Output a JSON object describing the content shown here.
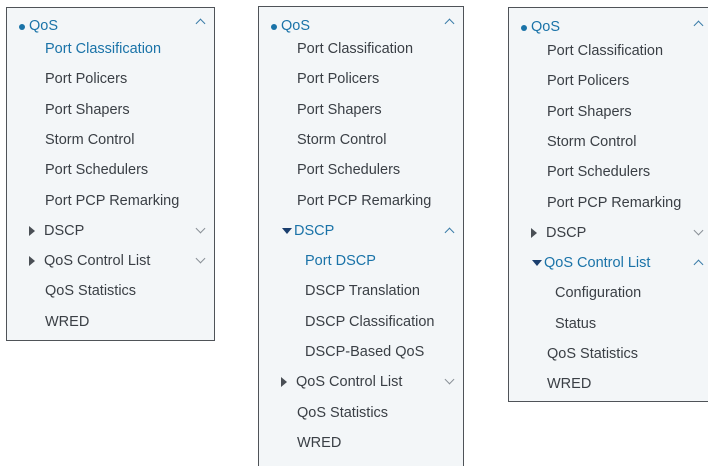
{
  "panels": [
    {
      "root": "QoS",
      "items": [
        "Port Classification",
        "Port Policers",
        "Port Shapers",
        "Storm Control",
        "Port Schedulers",
        "Port PCP Remarking"
      ],
      "active_item": "Port Classification",
      "dscp": {
        "label": "DSCP",
        "expanded": false,
        "children": []
      },
      "qcl": {
        "label": "QoS Control List",
        "expanded": false,
        "children": []
      },
      "tail": [
        "QoS Statistics",
        "WRED"
      ]
    },
    {
      "root": "QoS",
      "items": [
        "Port Classification",
        "Port Policers",
        "Port Shapers",
        "Storm Control",
        "Port Schedulers",
        "Port PCP Remarking"
      ],
      "active_item": "Port DSCP",
      "dscp": {
        "label": "DSCP",
        "expanded": true,
        "children": [
          "Port DSCP",
          "DSCP Translation",
          "DSCP Classification",
          "DSCP-Based QoS"
        ]
      },
      "qcl": {
        "label": "QoS Control List",
        "expanded": false,
        "children": []
      },
      "tail": [
        "QoS Statistics",
        "WRED"
      ]
    },
    {
      "root": "QoS",
      "items": [
        "Port Classification",
        "Port Policers",
        "Port Shapers",
        "Storm Control",
        "Port Schedulers",
        "Port PCP Remarking"
      ],
      "active_item": "",
      "dscp": {
        "label": "DSCP",
        "expanded": false,
        "children": []
      },
      "qcl": {
        "label": "QoS Control List",
        "expanded": true,
        "children": [
          "Configuration",
          "Status"
        ]
      },
      "tail": [
        "QoS Statistics",
        "WRED"
      ]
    }
  ],
  "icons": {
    "bullet": "bullet-dot-icon",
    "collapse": "chevron-up-icon",
    "expand": "chevron-down-icon",
    "closed_group": "caret-right-icon",
    "open_group": "caret-down-icon"
  },
  "colors": {
    "panel_bg": "#f3f6f8",
    "border": "#4f5358",
    "text": "#3a3f45",
    "accent": "#1a73a8"
  }
}
